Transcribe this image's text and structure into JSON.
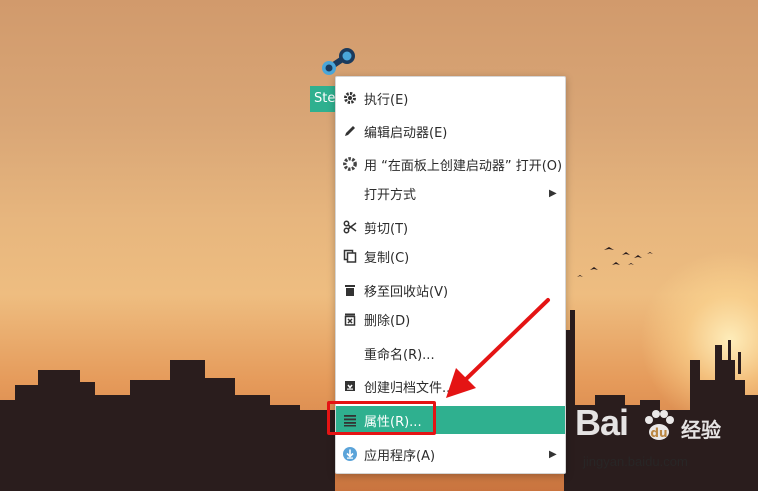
{
  "desktop": {
    "icon_label": "Ste"
  },
  "context_menu": {
    "items": [
      {
        "label": "执行(E)",
        "icon": "gear-icon"
      },
      {
        "label": "编辑启动器(E)",
        "icon": "pencil-icon"
      },
      {
        "label": "用 “在面板上创建启动器” 打开(O)",
        "icon": "gear-icon"
      },
      {
        "label": "打开方式",
        "icon": "",
        "submenu": true
      },
      {
        "label": "剪切(T)",
        "icon": "scissors-icon"
      },
      {
        "label": "复制(C)",
        "icon": "copy-icon"
      },
      {
        "label": "移至回收站(V)",
        "icon": "trash-icon"
      },
      {
        "label": "删除(D)",
        "icon": "delete-icon"
      },
      {
        "label": "重命名(R)...",
        "icon": ""
      },
      {
        "label": "创建归档文件...",
        "icon": "archive-icon"
      },
      {
        "label": "属性(R)...",
        "icon": "properties-icon",
        "highlighted": true
      },
      {
        "label": "应用程序(A)",
        "icon": "download-icon",
        "submenu": true
      }
    ]
  },
  "watermark": {
    "brand": "Bai",
    "brand_suffix": "经验",
    "url": "jingyan.baidu.com"
  },
  "colors": {
    "highlight": "#2fb08f",
    "annotation_red": "#e41414"
  }
}
